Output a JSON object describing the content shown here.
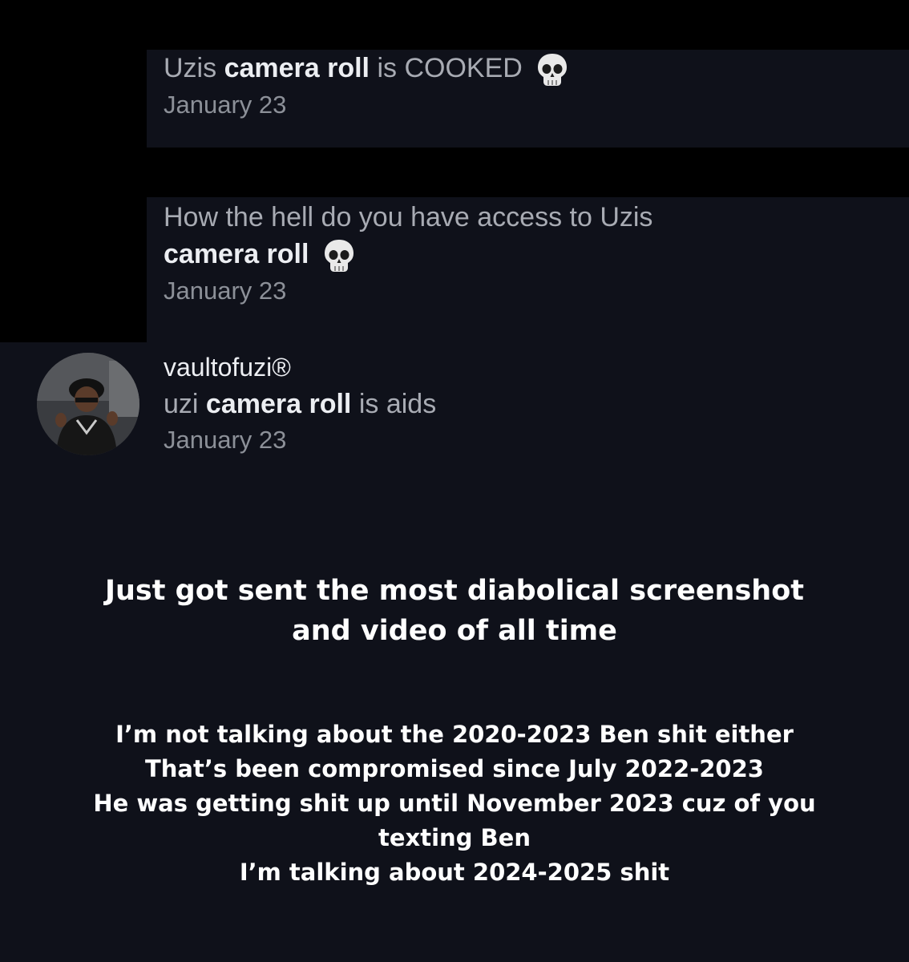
{
  "comments": [
    {
      "text_start": "Uzis ",
      "text_bold": "camera roll",
      "text_end": " is COOKED",
      "emoji": "skull-emoji",
      "date": "January 23"
    },
    {
      "line1": "How the hell do you have access to Uzis",
      "text_bold": "camera roll",
      "emoji": "skull-emoji",
      "date": "January 23"
    },
    {
      "username": "vaultofuzi®",
      "text_start": "uzi ",
      "text_bold": "camera roll",
      "text_end": " is aids",
      "date": "January 23"
    }
  ],
  "caption": {
    "headline_lines": [
      "Just got sent the most diabolical screenshot",
      "and video of all time"
    ],
    "body_lines": [
      "I’m not talking about the 2020-2023 Ben shit either",
      "That’s been compromised since July 2022-2023",
      "He was getting shit up until November 2023 cuz of you",
      "texting Ben",
      "I’m talking about 2024-2025 shit"
    ]
  },
  "colors": {
    "background": "#0f111a",
    "text_primary": "#eceef2",
    "text_muted": "#a8abb3",
    "date": "#8c9098",
    "caption": "#ffffff"
  }
}
